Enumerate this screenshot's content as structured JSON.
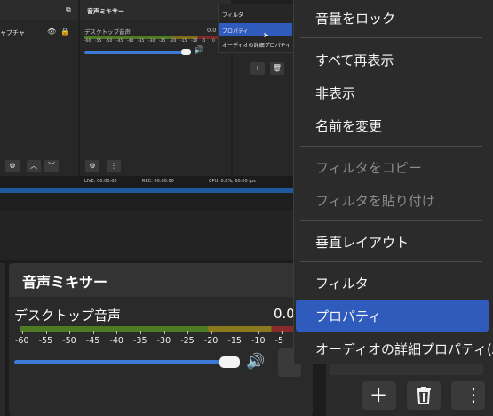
{
  "thumbnail": {
    "sources_item": "ャプチャ",
    "mixer_title": "音声ミキサー",
    "desktop_audio": "デスクトップ音声",
    "desktop_value": "0.0",
    "ticks": [
      "-60",
      "-55",
      "-50",
      "-45",
      "-40",
      "-35",
      "-30",
      "-25",
      "-20",
      "-15",
      "-10",
      "-5",
      "0"
    ],
    "status_live": "LIVE: 00:00:00",
    "status_rec": "REC: 00:00:00",
    "status_cpu": "CPU: 0.8%, 60.00 fps",
    "mini_menu": [
      "フィルタ",
      "プロパティ",
      "オーディオの詳細プロパティ"
    ]
  },
  "mixer": {
    "title": "音声ミキサー",
    "track_name": "デスクトップ音声",
    "track_value": "0.0",
    "ticks": [
      "-60",
      "-55",
      "-50",
      "-45",
      "-40",
      "-35",
      "-30",
      "-25",
      "-20",
      "-15",
      "-10",
      "-5"
    ],
    "volume_level": 0.93
  },
  "menu": {
    "items": [
      {
        "label": "音量をロック",
        "enabled": true
      },
      {
        "label": "すべて再表示",
        "enabled": true
      },
      {
        "label": "非表示",
        "enabled": true
      },
      {
        "label": "名前を変更",
        "enabled": true
      },
      {
        "label": "フィルタをコピー",
        "enabled": false
      },
      {
        "label": "フィルタを貼り付け",
        "enabled": false
      },
      {
        "label": "垂直レイアウト",
        "enabled": true
      },
      {
        "label": "フィルタ",
        "enabled": true
      },
      {
        "label": "プロパティ",
        "enabled": true,
        "highlighted": true
      },
      {
        "label": "オーディオの詳細プロパティ(A)",
        "enabled": true
      }
    ]
  },
  "icons": {
    "add": "plus-icon",
    "delete": "trash-icon",
    "more": "kebab-icon",
    "speaker": "speaker-icon",
    "gear": "gear-icon",
    "lock": "lock-icon",
    "eye": "eye-icon"
  },
  "colors": {
    "accent": "#2f5bbd",
    "slider": "#3b7bd6"
  }
}
